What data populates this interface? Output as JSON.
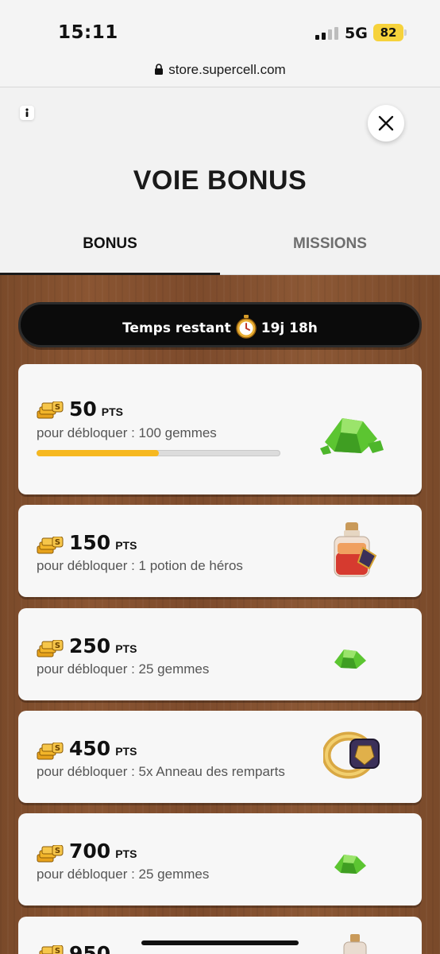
{
  "status_bar": {
    "time": "15:11",
    "network": "5G",
    "battery": "82"
  },
  "browser": {
    "url": "store.supercell.com"
  },
  "modal": {
    "title": "VOIE BONUS",
    "tabs": [
      {
        "label": "BONUS",
        "active": true
      },
      {
        "label": "MISSIONS",
        "active": false
      }
    ]
  },
  "timer": {
    "label": "Temps restant",
    "value": "19j 18h"
  },
  "pts_unit": "PTS",
  "rewards": [
    {
      "points": "50",
      "text": "pour débloquer : 100 gemmes",
      "progress": 0.5,
      "icon": "gems-icon"
    },
    {
      "points": "150",
      "text": "pour débloquer : 1 potion de héros",
      "icon": "hero-potion-icon"
    },
    {
      "points": "250",
      "text": "pour débloquer : 25 gemmes",
      "icon": "gem-icon"
    },
    {
      "points": "450",
      "text": "pour débloquer : 5x Anneau des remparts",
      "icon": "rampart-ring-icon"
    },
    {
      "points": "700",
      "text": "pour débloquer : 25 gemmes",
      "icon": "gem-icon"
    },
    {
      "points": "950",
      "icon": "potion-icon"
    }
  ],
  "colors": {
    "progress": "#f6b820",
    "wood": "#7d4b2c",
    "gem": "#5cc531"
  }
}
